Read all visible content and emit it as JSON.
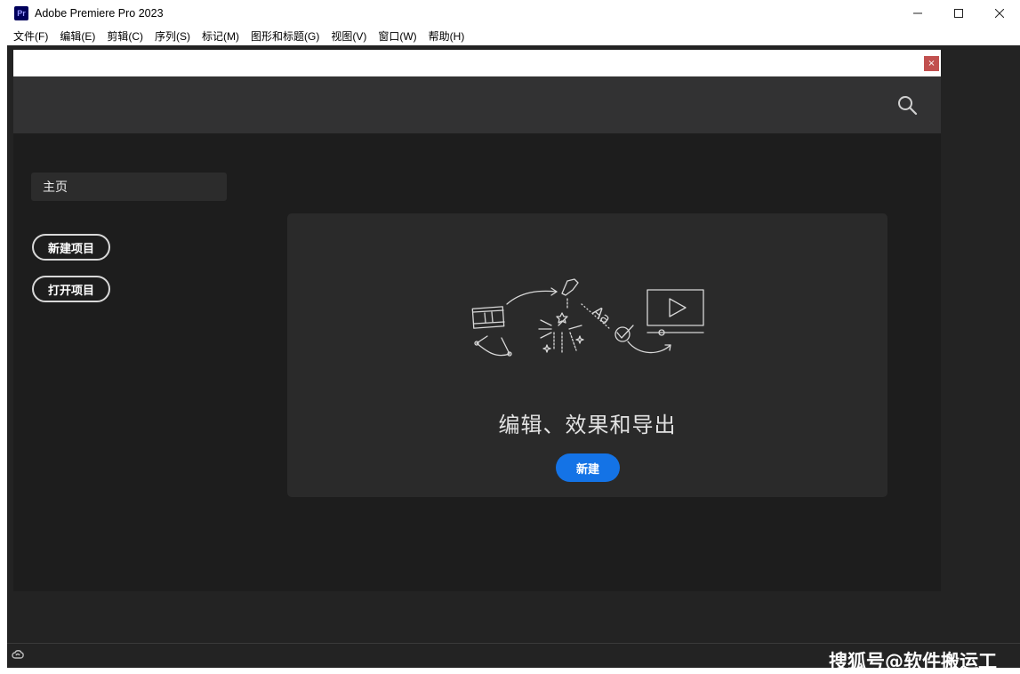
{
  "window": {
    "app_icon_text": "Pr",
    "title": "Adobe Premiere Pro 2023",
    "controls": [
      "minimize-icon",
      "maximize-icon",
      "close-icon"
    ]
  },
  "menubar": {
    "items": [
      {
        "label": "文件(F)"
      },
      {
        "label": "编辑(E)"
      },
      {
        "label": "剪辑(C)"
      },
      {
        "label": "序列(S)"
      },
      {
        "label": "标记(M)"
      },
      {
        "label": "图形和标题(G)"
      },
      {
        "label": "视图(V)"
      },
      {
        "label": "窗口(W)"
      },
      {
        "label": "帮助(H)"
      }
    ]
  },
  "dialog": {
    "close_label": "×",
    "search_icon": "search-icon",
    "sidebar": {
      "home_tab": "主页",
      "new_project": "新建项目",
      "open_project": "打开项目"
    },
    "card": {
      "title": "编辑、效果和导出",
      "new_button": "新建",
      "illustration_text": "Aa"
    },
    "colors": {
      "accent": "#1473e6",
      "dialog_bg": "#1d1d1d",
      "header_bg": "#323233",
      "card_bg": "#2a2a2a",
      "close_bg": "#c1504f"
    }
  },
  "statusbar": {
    "icon": "creative-cloud-icon"
  },
  "watermark": "搜狐号@软件搬运工"
}
